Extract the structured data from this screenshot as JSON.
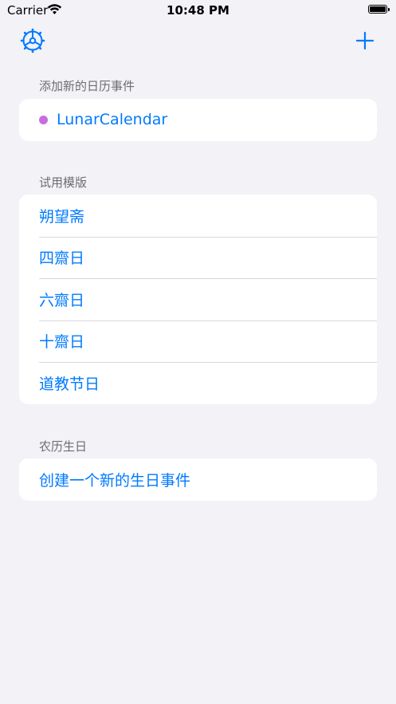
{
  "status_bar": {
    "carrier": "Carrier",
    "time": "10:48 PM",
    "wifi_icon": "wifi-icon",
    "battery_icon": "battery-icon"
  },
  "nav": {
    "settings_icon": "gear-icon",
    "add_icon": "plus-icon"
  },
  "colors": {
    "accent": "#007aff",
    "calendar_dot": "#c86ddf",
    "background": "#f2f2f7",
    "card": "#ffffff",
    "section_text": "#6d6d72"
  },
  "sections": {
    "add_event": {
      "header": "添加新的日历事件",
      "calendar": {
        "name": "LunarCalendar",
        "color": "#c86ddf"
      }
    },
    "templates": {
      "header": "试用模版",
      "items": [
        "朔望斋",
        "四齋日",
        "六齋日",
        "十齋日",
        "道教节日"
      ]
    },
    "lunar_birthday": {
      "header": "农历生日",
      "create_label": "创建一个新的生日事件"
    }
  }
}
